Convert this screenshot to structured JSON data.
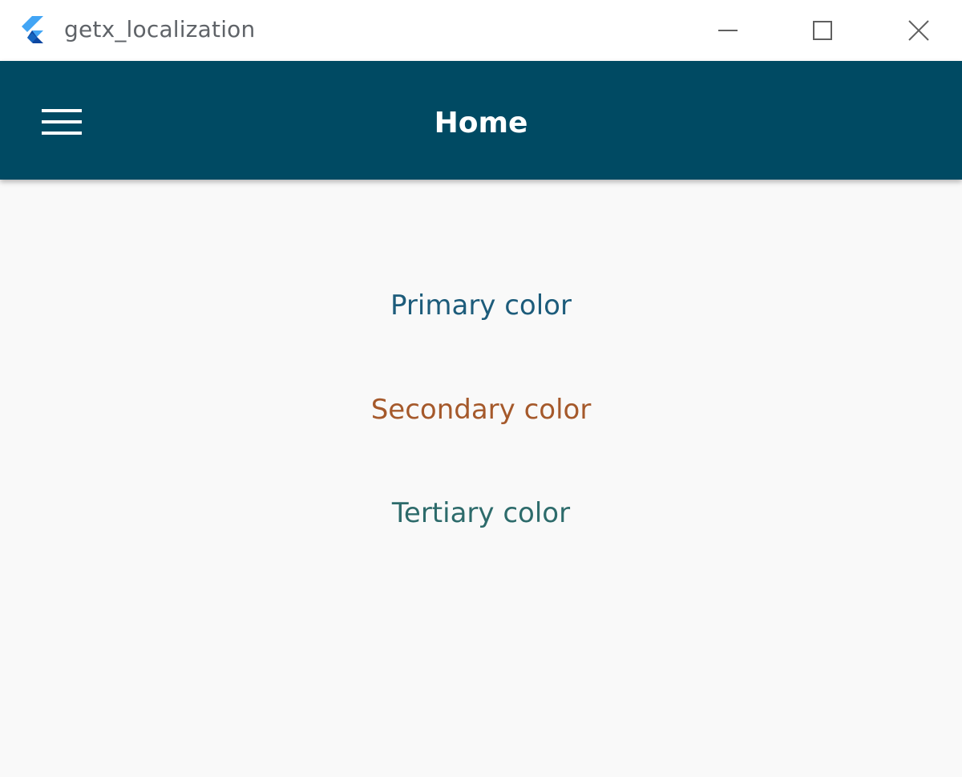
{
  "window": {
    "title": "getx_localization",
    "logo_icon": "flutter-logo-icon",
    "controls": {
      "minimize_icon": "minimize-icon",
      "maximize_icon": "maximize-icon",
      "close_icon": "close-icon"
    }
  },
  "appbar": {
    "title": "Home",
    "menu_icon": "hamburger-menu-icon",
    "background": "#004a63"
  },
  "content": {
    "items": [
      {
        "label": "Primary color",
        "color": "#1d5c7b"
      },
      {
        "label": "Secondary color",
        "color": "#a5592b"
      },
      {
        "label": "Tertiary color",
        "color": "#2d6b6b"
      }
    ]
  }
}
